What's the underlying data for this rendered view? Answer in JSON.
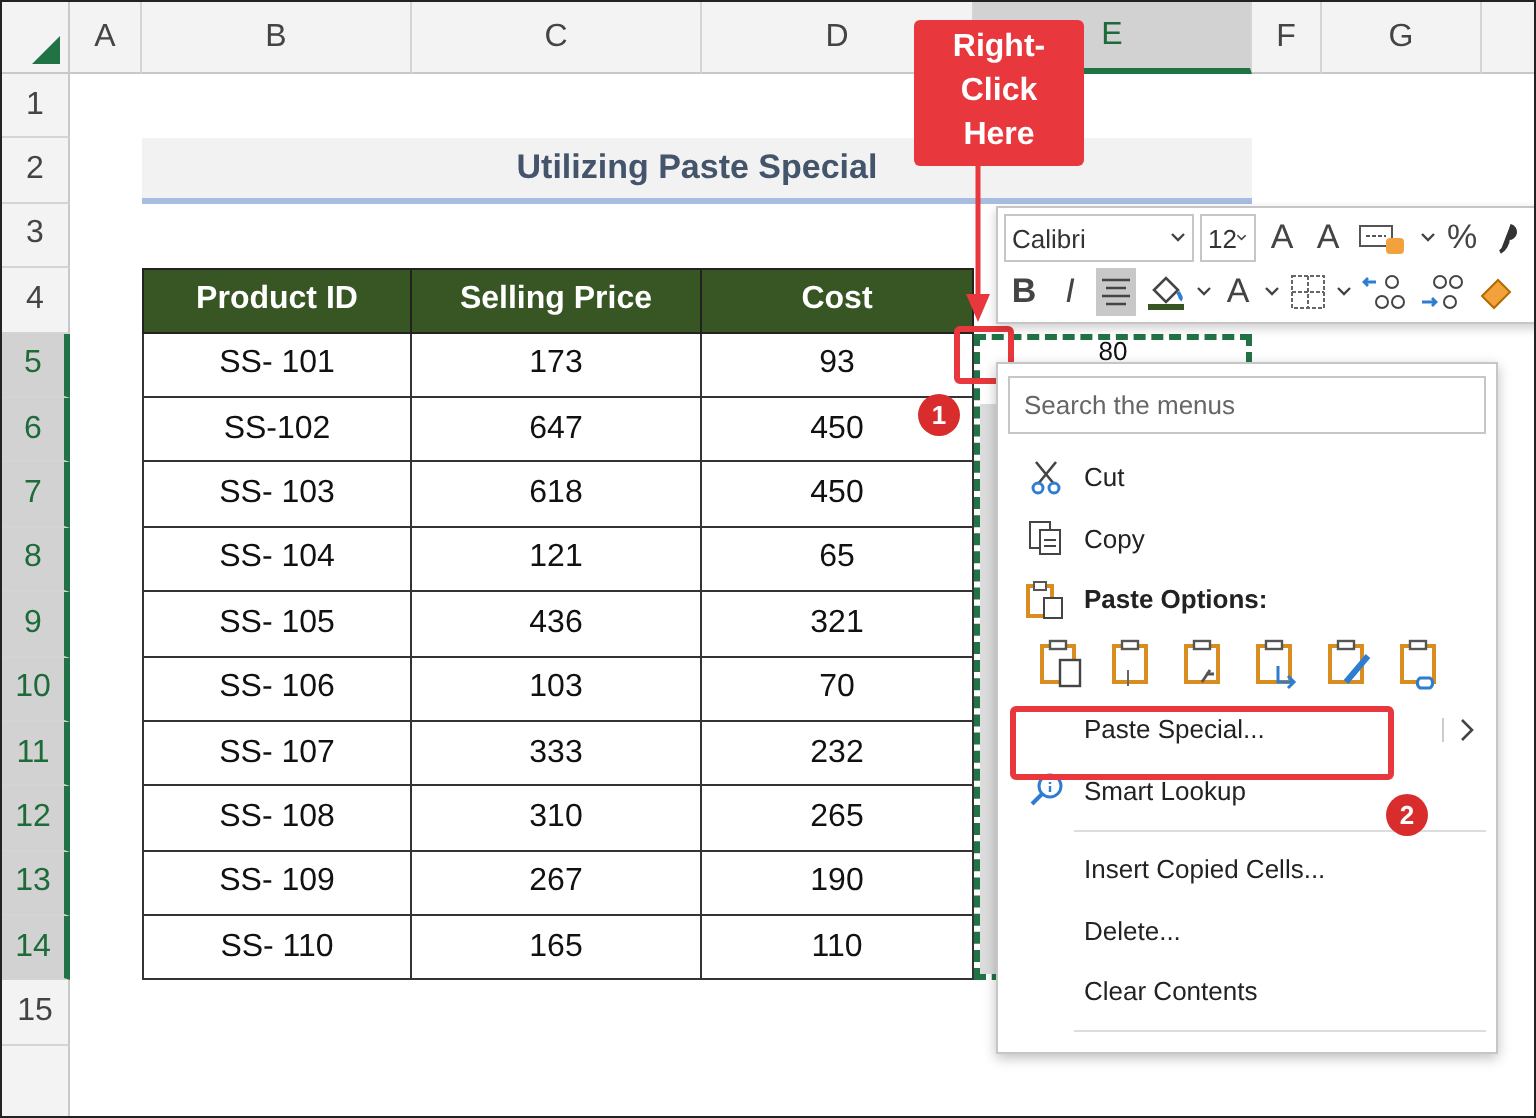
{
  "sheet": {
    "columns": [
      {
        "label": "A",
        "selected": false
      },
      {
        "label": "B",
        "selected": false
      },
      {
        "label": "C",
        "selected": false
      },
      {
        "label": "D",
        "selected": false
      },
      {
        "label": "E",
        "selected": true
      },
      {
        "label": "F",
        "selected": false
      },
      {
        "label": "G",
        "selected": false
      }
    ],
    "rows": [
      {
        "label": "1",
        "selected": false
      },
      {
        "label": "2",
        "selected": false
      },
      {
        "label": "3",
        "selected": false
      },
      {
        "label": "4",
        "selected": false
      },
      {
        "label": "5",
        "selected": true
      },
      {
        "label": "6",
        "selected": true
      },
      {
        "label": "7",
        "selected": true
      },
      {
        "label": "8",
        "selected": true
      },
      {
        "label": "9",
        "selected": true
      },
      {
        "label": "10",
        "selected": true
      },
      {
        "label": "11",
        "selected": true
      },
      {
        "label": "12",
        "selected": true
      },
      {
        "label": "13",
        "selected": true
      },
      {
        "label": "14",
        "selected": true
      },
      {
        "label": "15",
        "selected": false
      }
    ],
    "title": "Utilizing Paste Special",
    "table": {
      "columns": [
        "Product ID",
        "Selling Price",
        "Cost"
      ],
      "rows": [
        [
          "SS- 101",
          "173",
          "93"
        ],
        [
          "SS-102",
          "647",
          "450"
        ],
        [
          "SS- 103",
          "618",
          "450"
        ],
        [
          "SS- 104",
          "121",
          "65"
        ],
        [
          "SS- 105",
          "436",
          "321"
        ],
        [
          "SS- 106",
          "103",
          "70"
        ],
        [
          "SS- 107",
          "333",
          "232"
        ],
        [
          "SS- 108",
          "310",
          "265"
        ],
        [
          "SS- 109",
          "267",
          "190"
        ],
        [
          "SS- 110",
          "165",
          "110"
        ]
      ]
    },
    "copied_column": {
      "first_value": "80"
    }
  },
  "mini_toolbar": {
    "font_controls": [
      {
        "kind": "dropdown",
        "label": "Calibri"
      },
      {
        "kind": "dropdown",
        "label": "12"
      },
      {
        "kind": "text",
        "label": "A"
      },
      {
        "kind": "text",
        "label": "A"
      },
      {
        "kind": "icon"
      },
      {
        "kind": "caret"
      },
      {
        "kind": "text",
        "label": "%"
      },
      {
        "kind": "icon"
      }
    ],
    "format_controls": [
      {
        "kind": "toggle",
        "label": "B",
        "on": false
      },
      {
        "kind": "toggle",
        "label": "I",
        "on": false
      },
      {
        "kind": "toggle",
        "on": true
      },
      {
        "kind": "icon"
      },
      {
        "kind": "caret"
      },
      {
        "kind": "text",
        "label": "A"
      },
      {
        "kind": "caret"
      },
      {
        "kind": "icon"
      },
      {
        "kind": "caret"
      },
      {
        "kind": "icon"
      },
      {
        "kind": "icon"
      },
      {
        "kind": "icon"
      }
    ]
  },
  "context_menu": {
    "search": {
      "placeholder": "Search the menus"
    },
    "items": [
      {
        "kind": "icon-item",
        "label": "Cut"
      },
      {
        "kind": "icon-item",
        "label": "Copy"
      },
      {
        "kind": "header",
        "label": "Paste Options:"
      },
      {
        "kind": "paste-row"
      },
      {
        "kind": "submenu",
        "label": "Paste Special..."
      },
      {
        "kind": "icon-item",
        "label": "Smart Lookup"
      },
      {
        "kind": "separator"
      },
      {
        "kind": "plain",
        "label": "Insert Copied Cells..."
      },
      {
        "kind": "plain",
        "label": "Delete..."
      },
      {
        "kind": "plain",
        "label": "Clear Contents"
      },
      {
        "kind": "separator"
      }
    ]
  },
  "annotations": {
    "callout": "Right-Click Here",
    "steps": [
      "1",
      "2"
    ]
  }
}
